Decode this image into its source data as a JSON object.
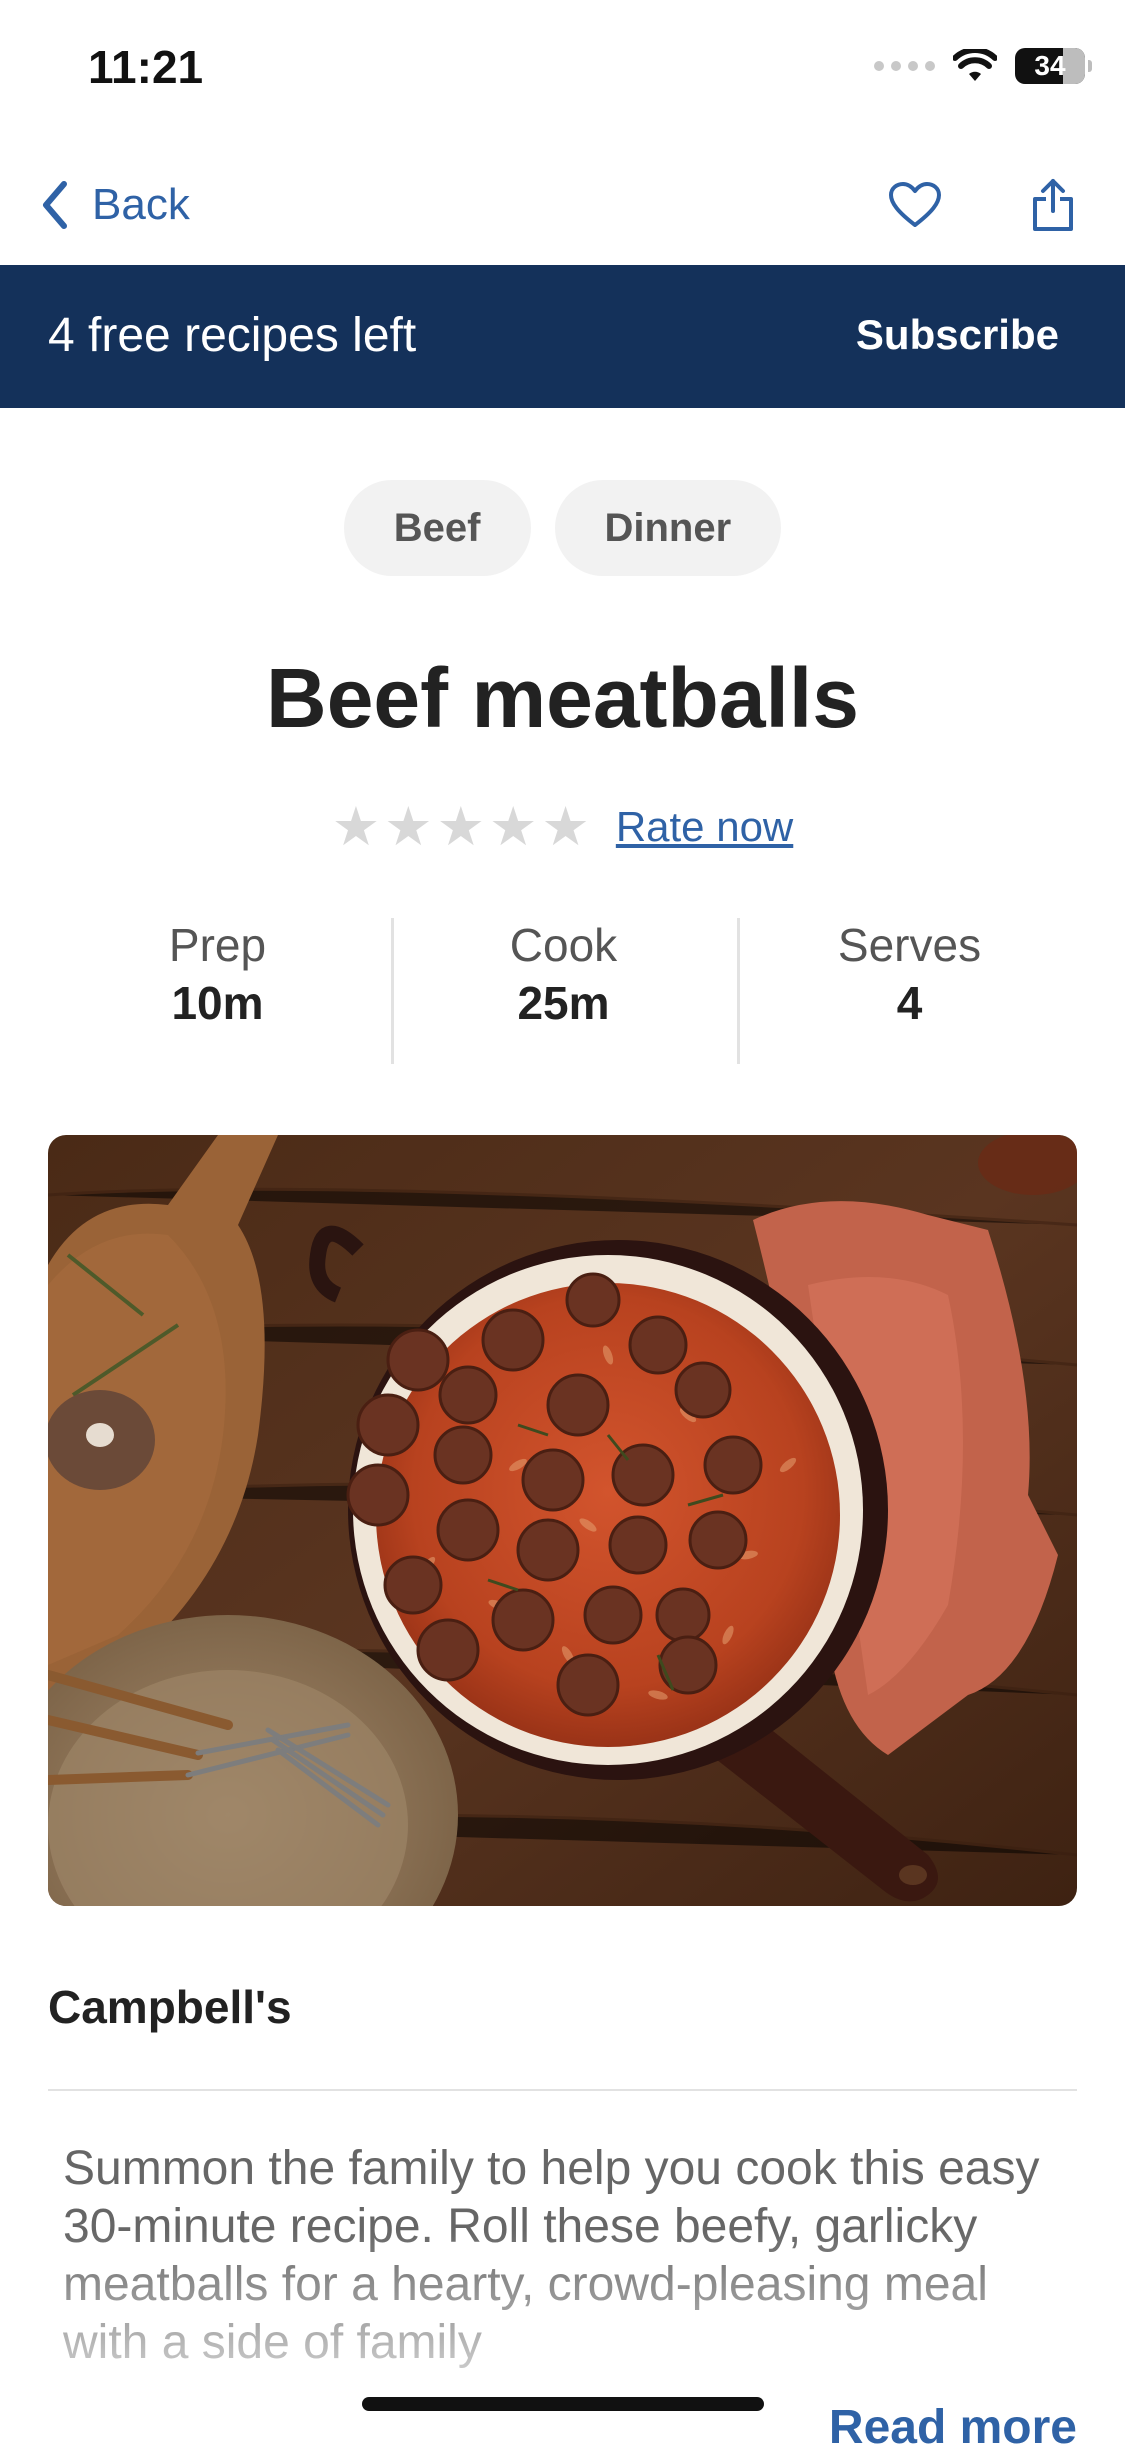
{
  "status_bar": {
    "time": "11:21",
    "battery_level": "34",
    "icons": [
      "cellular-signal-icon",
      "wifi-icon",
      "battery-icon"
    ]
  },
  "nav": {
    "back_label": "Back",
    "icons": [
      "chevron-left-icon",
      "heart-icon",
      "share-icon"
    ]
  },
  "banner": {
    "text": "4 free recipes left",
    "button_label": "Subscribe",
    "background": "#14315a"
  },
  "tags": [
    "Beef",
    "Dinner"
  ],
  "recipe": {
    "title": "Beef meatballs",
    "rating_stars": 0,
    "rate_label": "Rate now",
    "stats": [
      {
        "label": "Prep",
        "value": "10m"
      },
      {
        "label": "Cook",
        "value": "25m"
      },
      {
        "label": "Serves",
        "value": "4"
      }
    ],
    "brand": "Campbell's",
    "description": "Summon the family to help you cook this easy 30-minute recipe. Roll these beefy, garlicky meatballs for a hearty, crowd-pleasing meal with a side of family",
    "read_more": "Read more"
  },
  "colors": {
    "accent": "#2f62a6",
    "banner": "#14315a",
    "tag_bg": "#f2f2f2"
  }
}
